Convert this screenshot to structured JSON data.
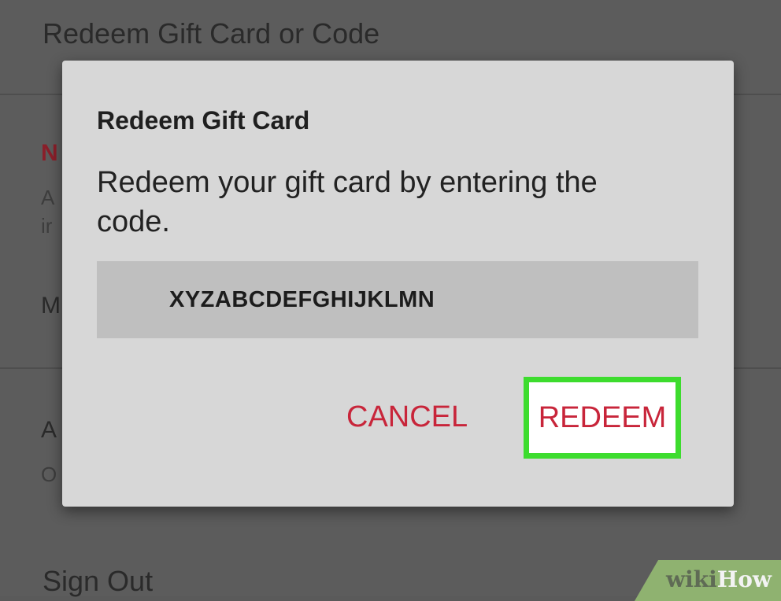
{
  "background": {
    "title": "Redeem Gift Card or Code",
    "fragments": [
      "N",
      "A",
      "ir",
      "M",
      "A",
      "O"
    ],
    "sign_out": "Sign Out"
  },
  "dialog": {
    "title": "Redeem Gift Card",
    "description": "Redeem your gift card by entering the code.",
    "code_value": "XYZABCDEFGHIJKLMN",
    "cancel_label": "CANCEL",
    "redeem_label": "REDEEM"
  },
  "watermark": {
    "prefix": "wiki",
    "suffix": "How"
  },
  "colors": {
    "accent": "#c8253a",
    "highlight": "#3ddc2e",
    "dialog_bg": "#d7d7d7",
    "input_bg": "#bfbfbf"
  }
}
